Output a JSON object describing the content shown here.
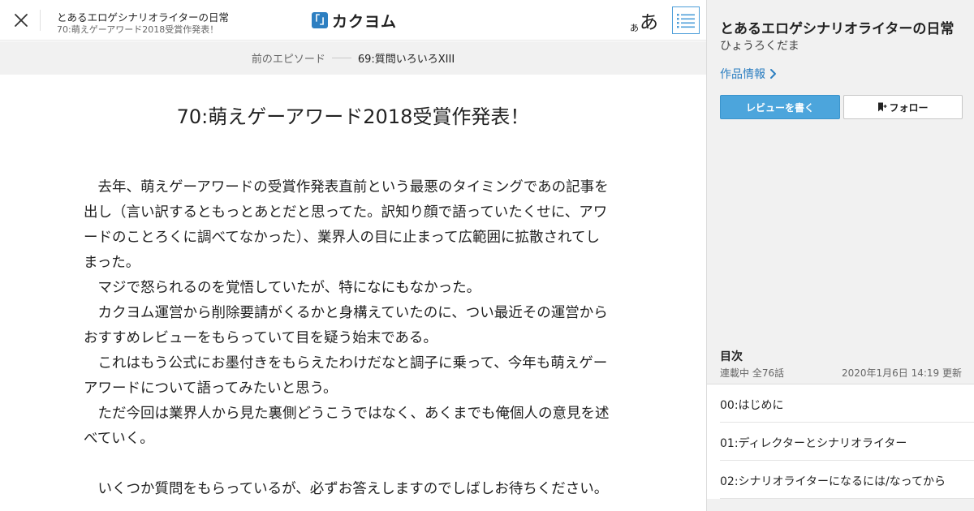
{
  "header": {
    "work_title": "とあるエロゲシナリオライターの日常",
    "episode_title": "70:萌えゲーアワード2018受賞作発表！",
    "logo_mark": "「」",
    "logo_text": "カクヨム",
    "font_small": "あ",
    "font_large": "あ",
    "icons": [
      "close-icon",
      "toc-list-icon"
    ],
    "accent_color": "#2d7fc1"
  },
  "episode_nav": {
    "prev_label": "前のエピソード",
    "prev_episode": "69:質問いろいろXIII"
  },
  "episode": {
    "title": "70:萌えゲーアワード2018受賞作発表！",
    "paragraphs": [
      "去年、萌えゲーアワードの受賞作発表直前という最悪のタイミングであの記事を出し（言い訳するともっとあとだと思ってた。訳知り顔で語っていたくせに、アワードのことろくに調べてなかった）、業界人の目に止まって広範囲に拡散されてしまった。",
      "マジで怒られるのを覚悟していたが、特になにもなかった。",
      "カクヨム運営から削除要請がくるかと身構えていたのに、つい最近その運営からおすすめレビューをもらっていて目を疑う始末である。",
      "これはもう公式にお墨付きをもらえたわけだなと調子に乗って、今年も萌えゲーアワードについて語ってみたいと思う。",
      "ただ今回は業界人から見た裏側どうこうではなく、あくまでも俺個人の意見を述べていく。",
      "",
      "いくつか質問をもらっているが、必ずお答えしますのでしばしお待ちください。"
    ]
  },
  "sidebar": {
    "work_title": "とあるエロゲシナリオライターの日常",
    "author": "ひょうろくだま",
    "work_info_link": "作品情報",
    "review_button": "レビューを書く",
    "follow_button": "フォロー",
    "toc": {
      "heading": "目次",
      "status": "連載中 全76話",
      "updated": "2020年1月6日 14:19 更新",
      "items": [
        {
          "label": "00:はじめに"
        },
        {
          "label": "01:ディレクターとシナリオライター"
        },
        {
          "label": "02:シナリオライターになるには/なってから"
        }
      ]
    },
    "review_button_color": "#4ca5dc"
  }
}
